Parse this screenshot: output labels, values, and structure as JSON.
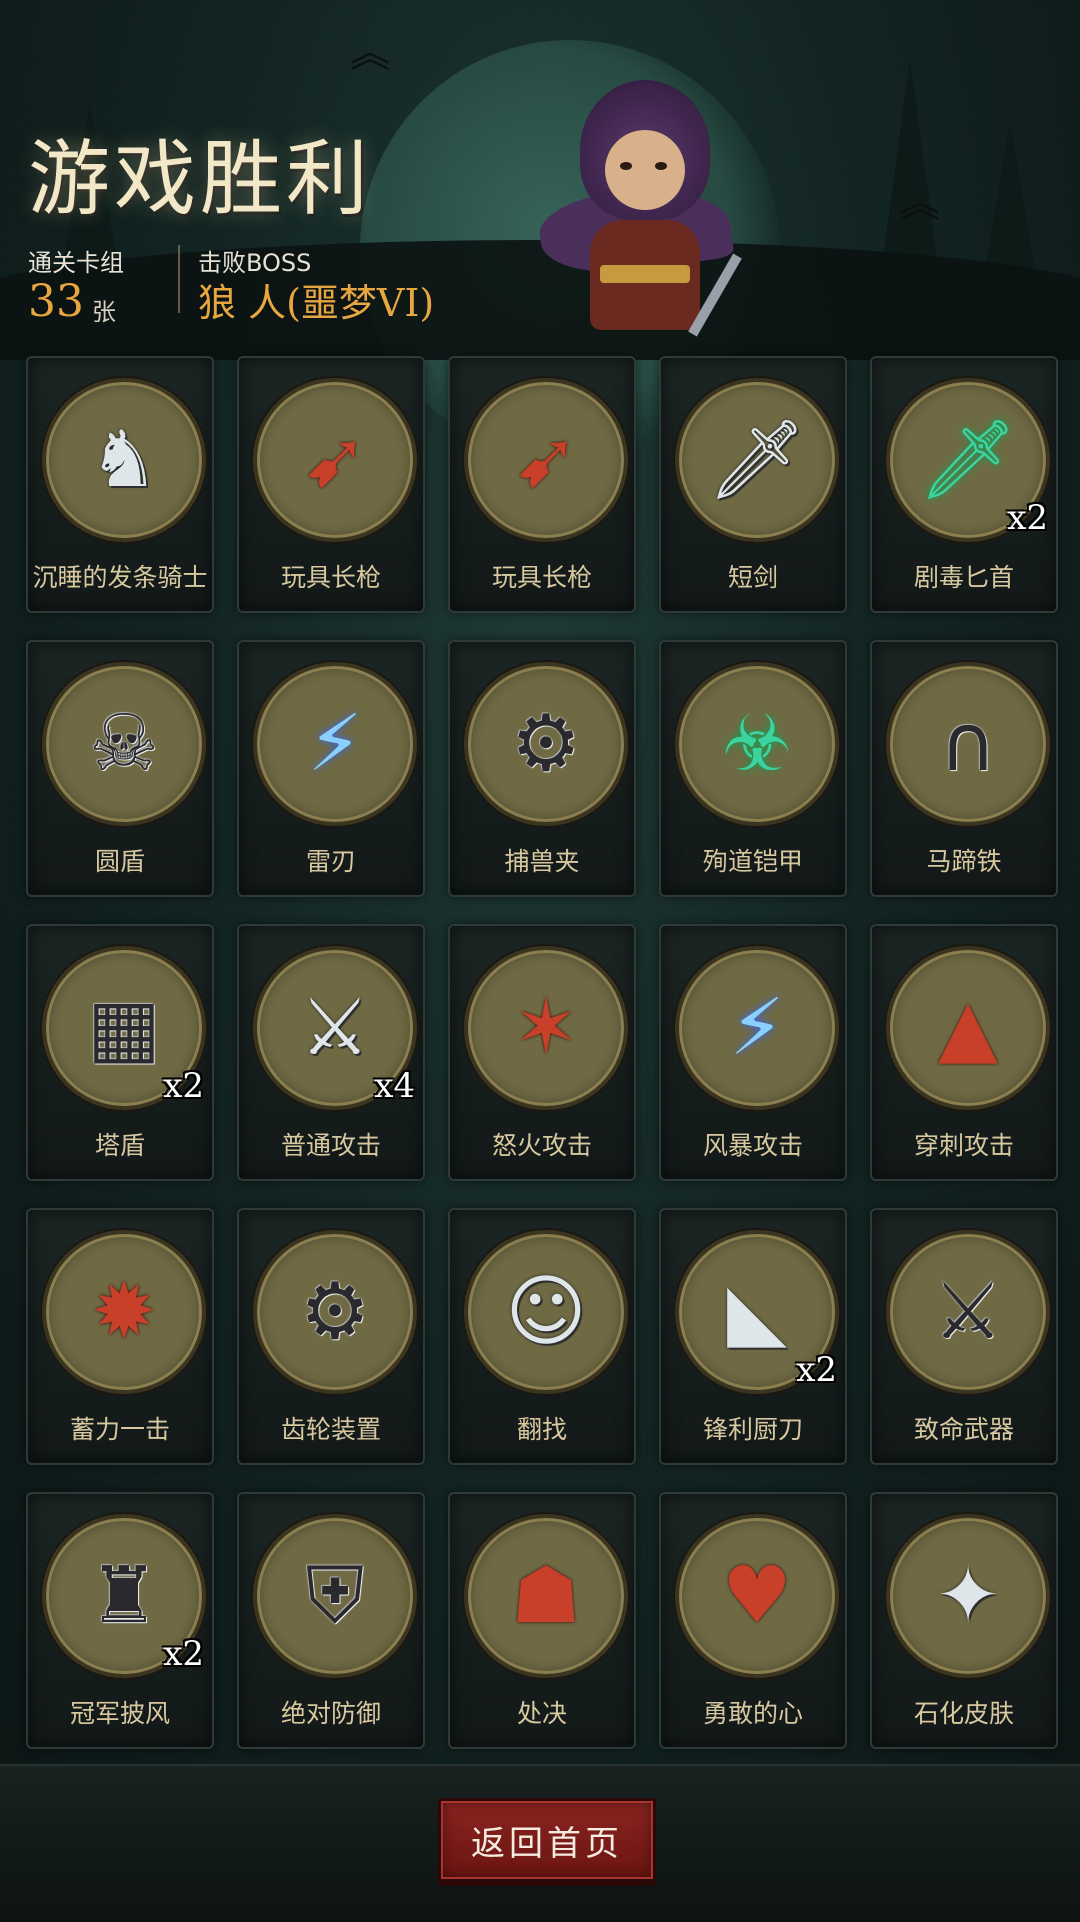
{
  "header": {
    "title": "游戏胜利",
    "deck_label": "通关卡组",
    "deck_count": "33",
    "deck_unit": "张",
    "boss_label": "击败BOSS",
    "boss_name": "狼 人(噩梦VI)"
  },
  "cards": [
    {
      "label": "沉睡的发条骑士",
      "icon": "clockwork-knight-icon",
      "glyph": "♞",
      "tone": "light",
      "count": ""
    },
    {
      "label": "玩具长枪",
      "icon": "toy-lance-icon",
      "glyph": "➹",
      "tone": "red",
      "count": ""
    },
    {
      "label": "玩具长枪",
      "icon": "toy-lance-icon",
      "glyph": "➹",
      "tone": "red",
      "count": ""
    },
    {
      "label": "短剑",
      "icon": "short-sword-icon",
      "glyph": "🗡",
      "tone": "light",
      "count": ""
    },
    {
      "label": "剧毒匕首",
      "icon": "poison-dagger-icon",
      "glyph": "🗡",
      "tone": "green",
      "count": "x2"
    },
    {
      "label": "圆盾",
      "icon": "round-shield-icon",
      "glyph": "☠",
      "tone": "",
      "count": ""
    },
    {
      "label": "雷刃",
      "icon": "thunder-blade-icon",
      "glyph": "⚡",
      "tone": "blue",
      "count": ""
    },
    {
      "label": "捕兽夹",
      "icon": "bear-trap-icon",
      "glyph": "⚙",
      "tone": "",
      "count": ""
    },
    {
      "label": "殉道铠甲",
      "icon": "martyr-armor-icon",
      "glyph": "☣",
      "tone": "green",
      "count": ""
    },
    {
      "label": "马蹄铁",
      "icon": "horseshoe-icon",
      "glyph": "∩",
      "tone": "",
      "count": ""
    },
    {
      "label": "塔盾",
      "icon": "tower-shield-icon",
      "glyph": "▦",
      "tone": "",
      "count": "x2"
    },
    {
      "label": "普通攻击",
      "icon": "basic-attack-icon",
      "glyph": "⚔",
      "tone": "light",
      "count": "x4"
    },
    {
      "label": "怒火攻击",
      "icon": "rage-attack-icon",
      "glyph": "✶",
      "tone": "red",
      "count": ""
    },
    {
      "label": "风暴攻击",
      "icon": "storm-attack-icon",
      "glyph": "⚡",
      "tone": "blue",
      "count": ""
    },
    {
      "label": "穿刺攻击",
      "icon": "pierce-attack-icon",
      "glyph": "▲",
      "tone": "red",
      "count": ""
    },
    {
      "label": "蓄力一击",
      "icon": "charged-strike-icon",
      "glyph": "✹",
      "tone": "red",
      "count": ""
    },
    {
      "label": "齿轮装置",
      "icon": "gear-device-icon",
      "glyph": "⚙",
      "tone": "",
      "count": ""
    },
    {
      "label": "翻找",
      "icon": "rummage-icon",
      "glyph": "☺",
      "tone": "light",
      "count": ""
    },
    {
      "label": "锋利厨刀",
      "icon": "cleaver-icon",
      "glyph": "◣",
      "tone": "light",
      "count": "x2"
    },
    {
      "label": "致命武器",
      "icon": "deadly-weapons-icon",
      "glyph": "⚔",
      "tone": "",
      "count": ""
    },
    {
      "label": "冠军披风",
      "icon": "champion-cloak-icon",
      "glyph": "♜",
      "tone": "",
      "count": "x2"
    },
    {
      "label": "绝对防御",
      "icon": "absolute-defense-icon",
      "glyph": "⛨",
      "tone": "",
      "count": ""
    },
    {
      "label": "处决",
      "icon": "execution-icon",
      "glyph": "☗",
      "tone": "red",
      "count": ""
    },
    {
      "label": "勇敢的心",
      "icon": "brave-heart-icon",
      "glyph": "♥",
      "tone": "red",
      "count": ""
    },
    {
      "label": "石化皮肤",
      "icon": "stone-skin-icon",
      "glyph": "✦",
      "tone": "light",
      "count": ""
    }
  ],
  "footer": {
    "home_label": "返回首页"
  }
}
